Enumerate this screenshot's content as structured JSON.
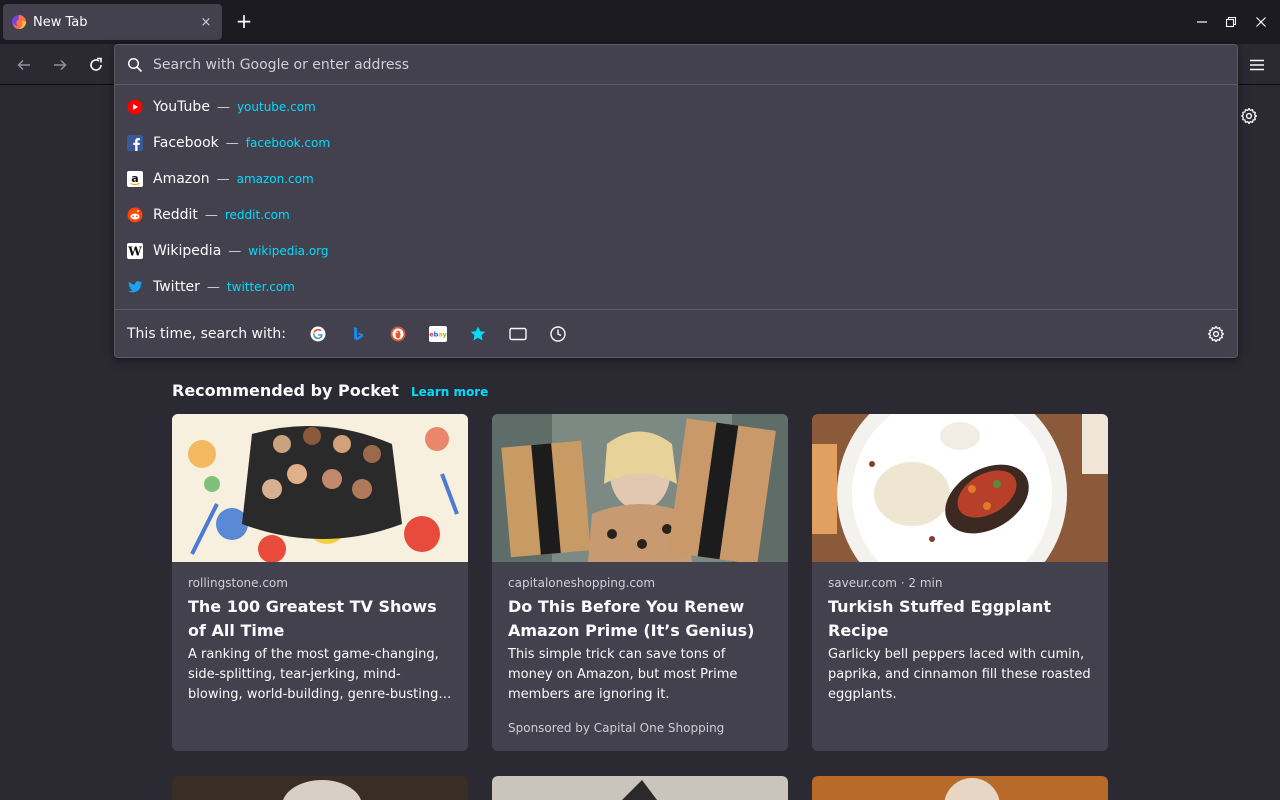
{
  "tab": {
    "title": "New Tab",
    "close": "×"
  },
  "newtab": {
    "label": "+"
  },
  "urlbar": {
    "placeholder": "Search with Google or enter address",
    "results": [
      {
        "name": "YouTube",
        "sep": "—",
        "url": "youtube.com",
        "icon": "youtube-icon",
        "color": "#ff0000"
      },
      {
        "name": "Facebook",
        "sep": "—",
        "url": "facebook.com",
        "icon": "facebook-icon",
        "color": "#3b5998"
      },
      {
        "name": "Amazon",
        "sep": "—",
        "url": "amazon.com",
        "icon": "amazon-icon",
        "color": "#ffffff"
      },
      {
        "name": "Reddit",
        "sep": "—",
        "url": "reddit.com",
        "icon": "reddit-icon",
        "color": "#ff4500"
      },
      {
        "name": "Wikipedia",
        "sep": "—",
        "url": "wikipedia.org",
        "icon": "wikipedia-icon",
        "color": "#ffffff"
      },
      {
        "name": "Twitter",
        "sep": "—",
        "url": "twitter.com",
        "icon": "twitter-icon",
        "color": "#1da1f2"
      }
    ],
    "oneoff_label": "This time, search with:",
    "engines": [
      "google-icon",
      "bing-icon",
      "duckduckgo-icon",
      "ebay-icon",
      "bookmarks-star-icon",
      "tabs-icon",
      "history-icon"
    ]
  },
  "pocket": {
    "title": "Recommended by Pocket",
    "learn_more": "Learn more",
    "cards": [
      {
        "source": "rollingstone.com",
        "title": "The 100 Greatest TV Shows of All Time",
        "excerpt": "A ranking of the most game-changing, side-splitting, tear-jerking, mind-blowing, world-building, genre-busting programs of the modern era",
        "sponsor": ""
      },
      {
        "source": "capitaloneshopping.com",
        "title": "Do This Before You Renew Amazon Prime (It’s Genius)",
        "excerpt": "This simple trick can save tons of money on Amazon, but most Prime members are ignoring it.",
        "sponsor": "Sponsored by Capital One Shopping"
      },
      {
        "source": "saveur.com · 2 min",
        "title": "Turkish Stuffed Eggplant Recipe",
        "excerpt": "Garlicky bell peppers laced with cumin, paprika, and cinnamon fill these roasted eggplants.",
        "sponsor": ""
      }
    ]
  },
  "colors": {
    "accent": "#00ddff",
    "panel": "#42414d",
    "bg": "#2b2a33",
    "tabstrip": "#1c1b22"
  }
}
